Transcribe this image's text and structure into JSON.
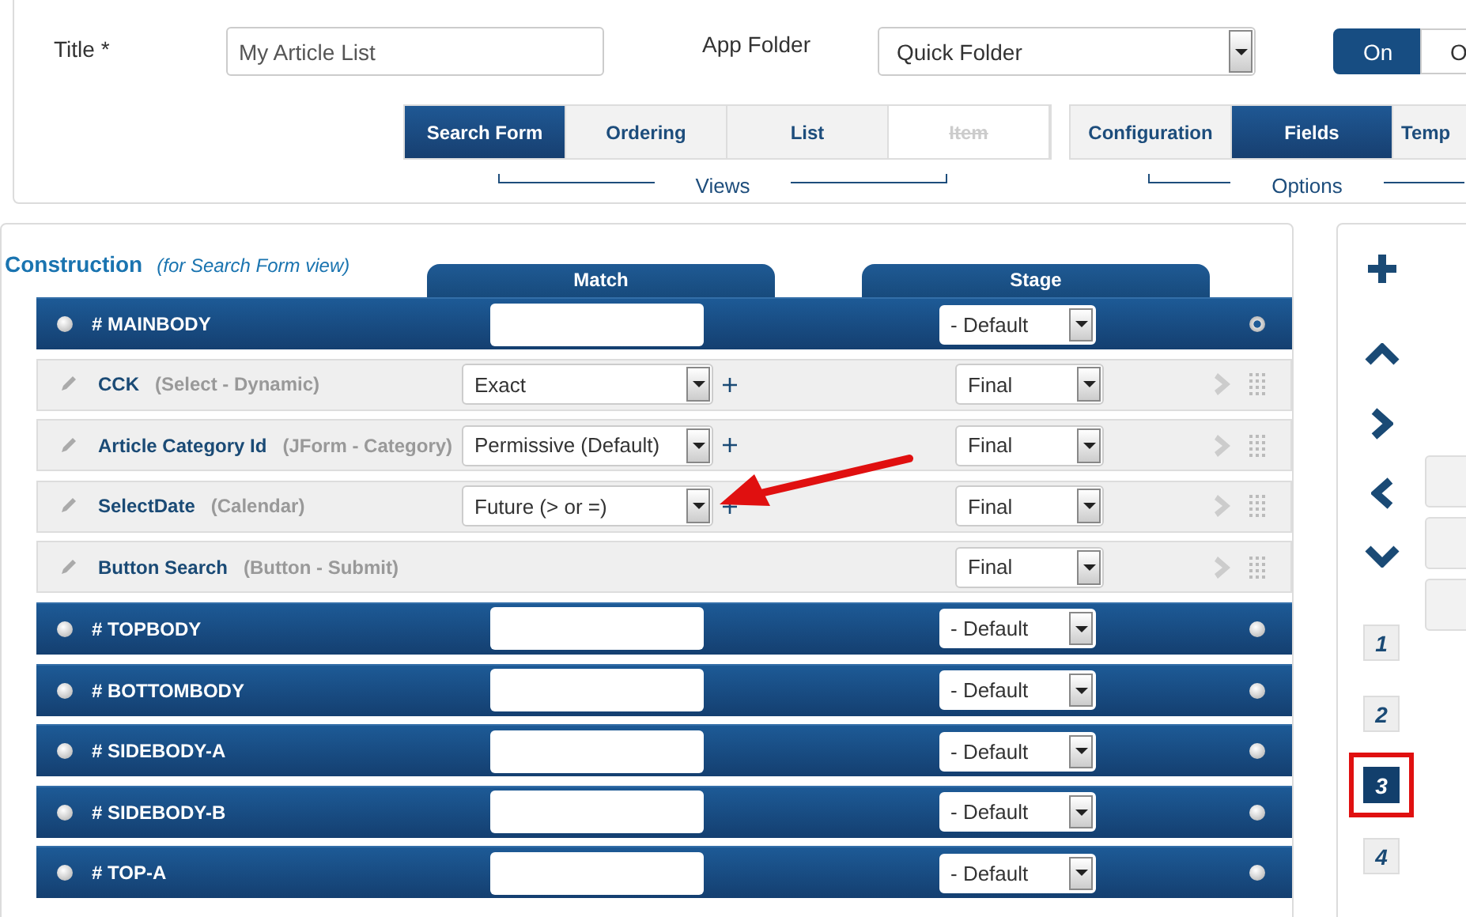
{
  "title_field": {
    "label": "Title",
    "required_mark": "*",
    "value": "My Article List"
  },
  "app_folder": {
    "label": "App Folder",
    "value": "Quick Folder"
  },
  "toggle": [
    {
      "label": "On",
      "selected": true
    },
    {
      "label": "O",
      "selected": false
    }
  ],
  "view_tabs": [
    {
      "label": "Search Form",
      "selected": true,
      "disabled": false
    },
    {
      "label": "Ordering",
      "selected": false,
      "disabled": false
    },
    {
      "label": "List",
      "selected": false,
      "disabled": false
    },
    {
      "label": "Item",
      "selected": false,
      "disabled": true
    }
  ],
  "views_caption": "Views",
  "option_tabs": [
    {
      "label": "Configuration",
      "selected": false
    },
    {
      "label": "Fields",
      "selected": true
    },
    {
      "label": "Temp",
      "selected": false
    }
  ],
  "options_caption": "Options",
  "construction": {
    "title": "Construction",
    "subtitle": "(for Search Form view)",
    "columns": [
      "Match",
      "Stage"
    ]
  },
  "rows": [
    {
      "kind": "position",
      "name": "# MAINBODY",
      "stage": "- Default",
      "selected": true
    },
    {
      "kind": "field",
      "name": "CCK",
      "type": "(Select - Dynamic)",
      "match": "Exact",
      "stage": "Final"
    },
    {
      "kind": "field",
      "name": "Article Category Id",
      "type": "(JForm - Category)",
      "match": "Permissive (Default)",
      "stage": "Final"
    },
    {
      "kind": "field",
      "name": "SelectDate",
      "type": "(Calendar)",
      "match": "Future (> or =)",
      "stage": "Final"
    },
    {
      "kind": "field",
      "name": "Button Search",
      "type": "(Button - Submit)",
      "stage": "Final"
    },
    {
      "kind": "position",
      "name": "# TOPBODY",
      "stage": "- Default",
      "selected": false
    },
    {
      "kind": "position",
      "name": "# BOTTOMBODY",
      "stage": "- Default",
      "selected": false
    },
    {
      "kind": "position",
      "name": "# SIDEBODY-A",
      "stage": "- Default",
      "selected": false
    },
    {
      "kind": "position",
      "name": "# SIDEBODY-B",
      "stage": "- Default",
      "selected": false
    },
    {
      "kind": "position",
      "name": "# TOP-A",
      "stage": "- Default",
      "selected": false
    }
  ],
  "pages": [
    {
      "label": "1",
      "selected": false,
      "highlighted": false
    },
    {
      "label": "2",
      "selected": false,
      "highlighted": false
    },
    {
      "label": "3",
      "selected": true,
      "highlighted": true
    },
    {
      "label": "4",
      "selected": false,
      "highlighted": false
    }
  ],
  "annotations": [
    {
      "kind": "arrow"
    }
  ]
}
